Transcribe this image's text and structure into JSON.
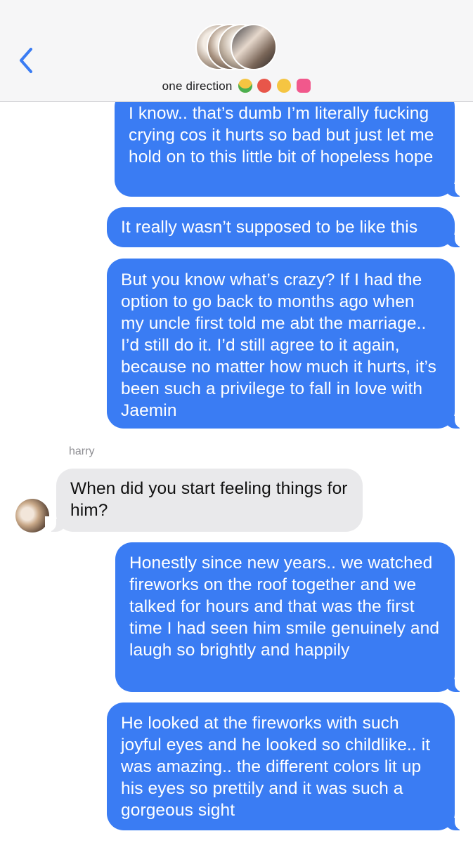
{
  "header": {
    "title": "one direction",
    "emojis": [
      "money-mouth-face-emoji",
      "face-with-thermometer-emoji",
      "zany-face-emoji",
      "heart-with-ribbon-emoji"
    ],
    "back_icon": "chevron-left-icon",
    "accent": "#3a7cf3"
  },
  "messages": [
    {
      "direction": "outgoing",
      "text": "I know.. that’s dumb I’m literally fucking crying cos it hurts so bad but just let me hold on to this little bit of hopeless hope"
    },
    {
      "direction": "outgoing",
      "text": "It really wasn’t supposed to be like this"
    },
    {
      "direction": "outgoing",
      "text": "But you know what’s crazy? If I had the option to go back to months ago when my uncle first told me abt the marriage.. I’d still do it. I’d still agree to it again, because no matter how much it hurts, it’s been such a privilege to fall in love with Jaemin"
    },
    {
      "direction": "incoming",
      "sender": "harry",
      "text": "When did you start feeling things for him?"
    },
    {
      "direction": "outgoing",
      "text": "Honestly since new years.. we watched fireworks on the roof together and we talked for hours and that was the first time I had seen him smile genuinely and laugh so brightly and happily"
    },
    {
      "direction": "outgoing",
      "text": "He looked at the fireworks with such joyful eyes and he looked so childlike.. it was amazing.. the different colors lit up his eyes so prettily and it was such a gorgeous sight"
    }
  ],
  "colors": {
    "outgoing_bubble": "#3a7cf3",
    "incoming_bubble": "#e9e9eb",
    "header_bg": "#f6f6f7"
  }
}
